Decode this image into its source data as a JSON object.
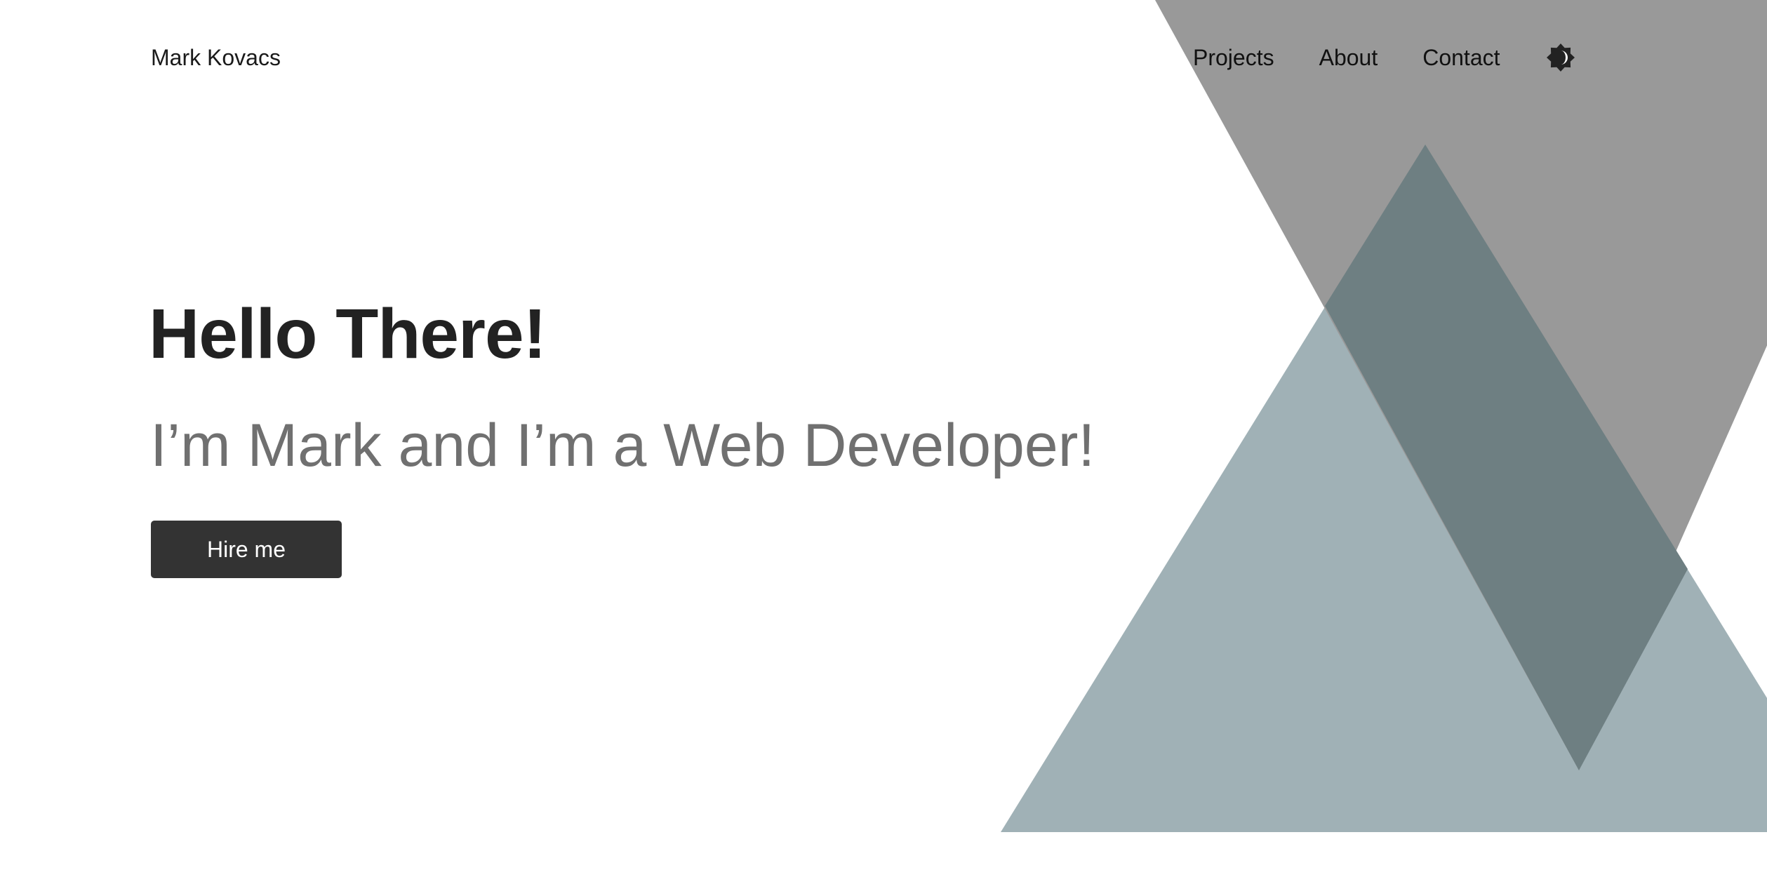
{
  "header": {
    "brand": "Mark Kovacs",
    "nav": {
      "projects": "Projects",
      "about": "About",
      "contact": "Contact"
    },
    "theme_toggle_icon": "contrast-icon"
  },
  "hero": {
    "title": "Hello There!",
    "subtitle": "I’m Mark and I’m a Web Developer!",
    "cta_label": "Hire me"
  },
  "colors": {
    "background": "#ffffff",
    "text": "#1a1a1a",
    "subtitle_text": "#707070",
    "button_bg": "#333333",
    "button_text": "#ffffff",
    "gray_triangle": "#999999",
    "blue_triangle": "#a0b1b6",
    "overlap": "#6e7f82"
  }
}
